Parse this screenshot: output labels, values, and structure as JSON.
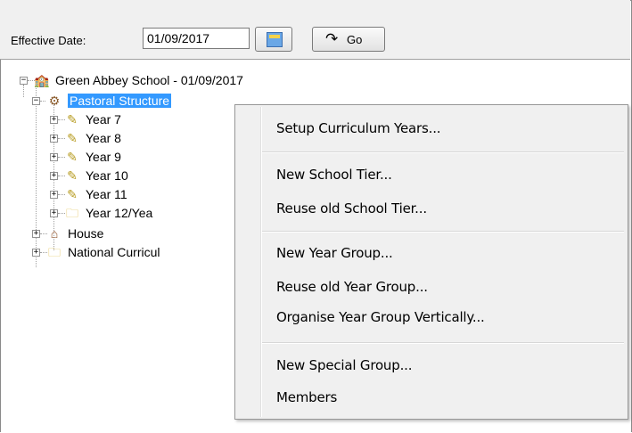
{
  "toolbar": {
    "effective_date_label": "Effective Date:",
    "effective_date_value": "01/09/2017",
    "go_label": "Go"
  },
  "tree": {
    "root_label": "Green Abbey School - 01/09/2017",
    "pastoral_label": "Pastoral Structure",
    "children": [
      {
        "label": "Year  7",
        "icon": "pencil-icon"
      },
      {
        "label": "Year  8",
        "icon": "pencil-icon"
      },
      {
        "label": "Year  9",
        "icon": "pencil-icon"
      },
      {
        "label": "Year 10",
        "icon": "pencil-icon"
      },
      {
        "label": "Year 11",
        "icon": "pencil-icon"
      },
      {
        "label": "Year 12/Yea",
        "icon": "folder-icon"
      }
    ],
    "house_label": "House",
    "national_label": "National Curricul"
  },
  "context_menu": {
    "items": [
      "Setup Curriculum Years...",
      "New School Tier...",
      "Reuse old School Tier...",
      "New Year Group...",
      "Reuse old Year Group...",
      "Organise Year Group Vertically...",
      "New Special Group...",
      "Members"
    ]
  },
  "colors": {
    "selection": "#3399ff",
    "toolbar_bg": "#f0f0f0",
    "menu_bg": "#f0f0f0"
  }
}
